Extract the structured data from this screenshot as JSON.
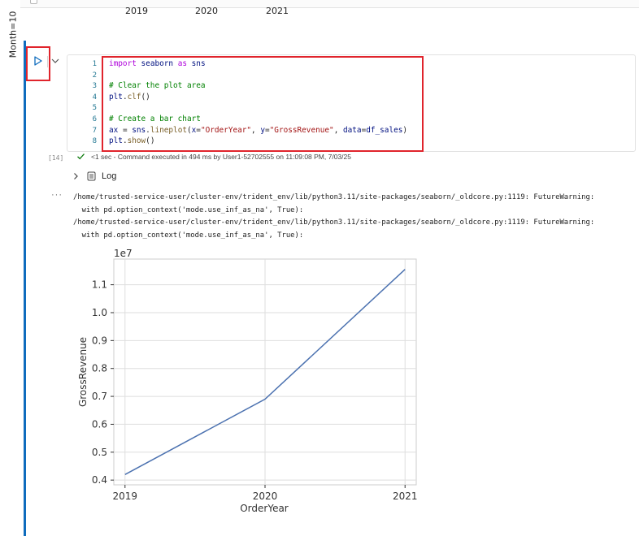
{
  "previous_output": {
    "axis_years": [
      "2019",
      "2020",
      "2021"
    ],
    "facet_label": "Month=10"
  },
  "cell": {
    "code_lines": [
      {
        "num": "1",
        "tokens": [
          [
            "kw",
            "import"
          ],
          [
            "",
            " "
          ],
          [
            "nm",
            "seaborn"
          ],
          [
            "",
            " "
          ],
          [
            "kw",
            "as"
          ],
          [
            "",
            " "
          ],
          [
            "nm",
            "sns"
          ]
        ]
      },
      {
        "num": "2",
        "tokens": []
      },
      {
        "num": "3",
        "tokens": [
          [
            "cm",
            "# Clear the plot area"
          ]
        ]
      },
      {
        "num": "4",
        "tokens": [
          [
            "nm",
            "plt"
          ],
          [
            "",
            ".",
            ""
          ],
          [
            "fn",
            "clf"
          ],
          [
            "",
            "()"
          ]
        ]
      },
      {
        "num": "5",
        "tokens": []
      },
      {
        "num": "6",
        "tokens": [
          [
            "cm",
            "# Create a bar chart"
          ]
        ]
      },
      {
        "num": "7",
        "tokens": [
          [
            "nm",
            "ax"
          ],
          [
            "",
            " = "
          ],
          [
            "nm",
            "sns"
          ],
          [
            "",
            "."
          ],
          [
            "fn",
            "lineplot"
          ],
          [
            "",
            "("
          ],
          [
            "nm",
            "x"
          ],
          [
            "",
            "="
          ],
          [
            "st",
            "\"OrderYear\""
          ],
          [
            "",
            ", "
          ],
          [
            "nm",
            "y"
          ],
          [
            "",
            "="
          ],
          [
            "st",
            "\"GrossRevenue\""
          ],
          [
            "",
            ", "
          ],
          [
            "nm",
            "data"
          ],
          [
            "",
            "="
          ],
          [
            "nm",
            "df_sales"
          ],
          [
            "",
            ")"
          ]
        ]
      },
      {
        "num": "8",
        "tokens": [
          [
            "nm",
            "plt"
          ],
          [
            "",
            "."
          ],
          [
            "fn",
            "show"
          ],
          [
            "",
            "()"
          ]
        ]
      }
    ],
    "exec_count": "[14]",
    "status_text": "<1 sec - Command executed in 494 ms by User1-52702555 on 11:09:08 PM, 7/03/25",
    "log_label": "Log",
    "more_label": "···",
    "warnings": [
      "/home/trusted-service-user/cluster-env/trident_env/lib/python3.11/site-packages/seaborn/_oldcore.py:1119: FutureWarning:",
      "  with pd.option_context('mode.use_inf_as_na', True):",
      "/home/trusted-service-user/cluster-env/trident_env/lib/python3.11/site-packages/seaborn/_oldcore.py:1119: FutureWarning:",
      "  with pd.option_context('mode.use_inf_as_na', True):"
    ]
  },
  "colors": {
    "accent": "#0f6cbd",
    "highlight": "#e0242c",
    "line": "#4c72b0",
    "success": "#107c10"
  },
  "chart_data": {
    "type": "line",
    "x": [
      2019,
      2020,
      2021
    ],
    "x_tick_labels": [
      "2019",
      "2020",
      "2021"
    ],
    "y": [
      0.42,
      0.69,
      1.155
    ],
    "y_ticks": [
      0.4,
      0.5,
      0.6,
      0.7,
      0.8,
      0.9,
      1.0,
      1.1
    ],
    "y_tick_labels": [
      "0.4",
      "0.5",
      "0.6",
      "0.7",
      "0.8",
      "0.9",
      "1.0",
      "1.1"
    ],
    "y_scale_label": "1e7",
    "xlabel": "OrderYear",
    "ylabel": "GrossRevenue",
    "xlim": [
      2018.92,
      2021.08
    ],
    "ylim": [
      0.383,
      1.192
    ],
    "grid": true
  }
}
